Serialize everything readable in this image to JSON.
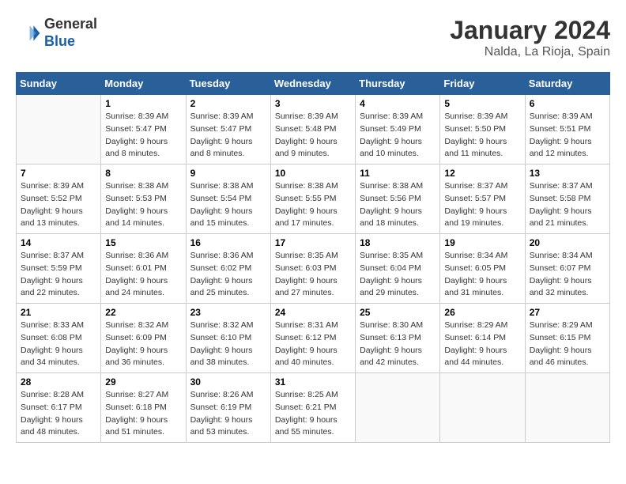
{
  "header": {
    "logo_general": "General",
    "logo_blue": "Blue",
    "title": "January 2024",
    "subtitle": "Nalda, La Rioja, Spain"
  },
  "days_of_week": [
    "Sunday",
    "Monday",
    "Tuesday",
    "Wednesday",
    "Thursday",
    "Friday",
    "Saturday"
  ],
  "weeks": [
    [
      {
        "day": "",
        "info": ""
      },
      {
        "day": "1",
        "info": "Sunrise: 8:39 AM\nSunset: 5:47 PM\nDaylight: 9 hours\nand 8 minutes."
      },
      {
        "day": "2",
        "info": "Sunrise: 8:39 AM\nSunset: 5:47 PM\nDaylight: 9 hours\nand 8 minutes."
      },
      {
        "day": "3",
        "info": "Sunrise: 8:39 AM\nSunset: 5:48 PM\nDaylight: 9 hours\nand 9 minutes."
      },
      {
        "day": "4",
        "info": "Sunrise: 8:39 AM\nSunset: 5:49 PM\nDaylight: 9 hours\nand 10 minutes."
      },
      {
        "day": "5",
        "info": "Sunrise: 8:39 AM\nSunset: 5:50 PM\nDaylight: 9 hours\nand 11 minutes."
      },
      {
        "day": "6",
        "info": "Sunrise: 8:39 AM\nSunset: 5:51 PM\nDaylight: 9 hours\nand 12 minutes."
      }
    ],
    [
      {
        "day": "7",
        "info": ""
      },
      {
        "day": "8",
        "info": "Sunrise: 8:38 AM\nSunset: 5:53 PM\nDaylight: 9 hours\nand 14 minutes."
      },
      {
        "day": "9",
        "info": "Sunrise: 8:38 AM\nSunset: 5:54 PM\nDaylight: 9 hours\nand 15 minutes."
      },
      {
        "day": "10",
        "info": "Sunrise: 8:38 AM\nSunset: 5:55 PM\nDaylight: 9 hours\nand 17 minutes."
      },
      {
        "day": "11",
        "info": "Sunrise: 8:38 AM\nSunset: 5:56 PM\nDaylight: 9 hours\nand 18 minutes."
      },
      {
        "day": "12",
        "info": "Sunrise: 8:37 AM\nSunset: 5:57 PM\nDaylight: 9 hours\nand 19 minutes."
      },
      {
        "day": "13",
        "info": "Sunrise: 8:37 AM\nSunset: 5:58 PM\nDaylight: 9 hours\nand 21 minutes."
      }
    ],
    [
      {
        "day": "14",
        "info": ""
      },
      {
        "day": "15",
        "info": "Sunrise: 8:36 AM\nSunset: 6:01 PM\nDaylight: 9 hours\nand 24 minutes."
      },
      {
        "day": "16",
        "info": "Sunrise: 8:36 AM\nSunset: 6:02 PM\nDaylight: 9 hours\nand 25 minutes."
      },
      {
        "day": "17",
        "info": "Sunrise: 8:35 AM\nSunset: 6:03 PM\nDaylight: 9 hours\nand 27 minutes."
      },
      {
        "day": "18",
        "info": "Sunrise: 8:35 AM\nSunset: 6:04 PM\nDaylight: 9 hours\nand 29 minutes."
      },
      {
        "day": "19",
        "info": "Sunrise: 8:34 AM\nSunset: 6:05 PM\nDaylight: 9 hours\nand 31 minutes."
      },
      {
        "day": "20",
        "info": "Sunrise: 8:34 AM\nSunset: 6:07 PM\nDaylight: 9 hours\nand 32 minutes."
      }
    ],
    [
      {
        "day": "21",
        "info": ""
      },
      {
        "day": "22",
        "info": "Sunrise: 8:32 AM\nSunset: 6:09 PM\nDaylight: 9 hours\nand 36 minutes."
      },
      {
        "day": "23",
        "info": "Sunrise: 8:32 AM\nSunset: 6:10 PM\nDaylight: 9 hours\nand 38 minutes."
      },
      {
        "day": "24",
        "info": "Sunrise: 8:31 AM\nSunset: 6:12 PM\nDaylight: 9 hours\nand 40 minutes."
      },
      {
        "day": "25",
        "info": "Sunrise: 8:30 AM\nSunset: 6:13 PM\nDaylight: 9 hours\nand 42 minutes."
      },
      {
        "day": "26",
        "info": "Sunrise: 8:29 AM\nSunset: 6:14 PM\nDaylight: 9 hours\nand 44 minutes."
      },
      {
        "day": "27",
        "info": "Sunrise: 8:29 AM\nSunset: 6:15 PM\nDaylight: 9 hours\nand 46 minutes."
      }
    ],
    [
      {
        "day": "28",
        "info": "Sunrise: 8:28 AM\nSunset: 6:17 PM\nDaylight: 9 hours\nand 48 minutes."
      },
      {
        "day": "29",
        "info": "Sunrise: 8:27 AM\nSunset: 6:18 PM\nDaylight: 9 hours\nand 51 minutes."
      },
      {
        "day": "30",
        "info": "Sunrise: 8:26 AM\nSunset: 6:19 PM\nDaylight: 9 hours\nand 53 minutes."
      },
      {
        "day": "31",
        "info": "Sunrise: 8:25 AM\nSunset: 6:21 PM\nDaylight: 9 hours\nand 55 minutes."
      },
      {
        "day": "",
        "info": ""
      },
      {
        "day": "",
        "info": ""
      },
      {
        "day": "",
        "info": ""
      }
    ]
  ],
  "week7_sunday": "Sunrise: 8:39 AM\nSunset: 5:52 PM\nDaylight: 9 hours\nand 13 minutes.",
  "week14_sunday": "Sunrise: 8:37 AM\nSunset: 5:59 PM\nDaylight: 9 hours\nand 22 minutes.",
  "week21_sunday": "Sunrise: 8:33 AM\nSunset: 6:08 PM\nDaylight: 9 hours\nand 34 minutes."
}
